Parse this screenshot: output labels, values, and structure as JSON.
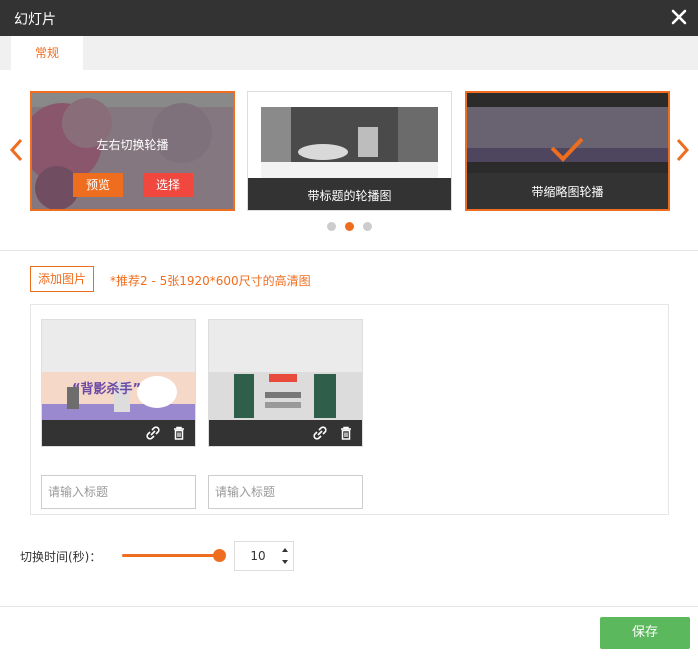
{
  "window": {
    "title": "幻灯片"
  },
  "tabs": [
    {
      "label": "常规"
    }
  ],
  "templates": [
    {
      "label": "左右切换轮播",
      "preview_label": "预览",
      "select_label": "选择"
    },
    {
      "label": "带标题的轮播图"
    },
    {
      "label": "带缩略图轮播"
    }
  ],
  "carousel": {
    "page_count": 3,
    "active_page": 2
  },
  "images": {
    "add_label": "添加图片",
    "hint": "*推荐2 - 5张1920*600尺寸的高清图",
    "items": [
      {
        "title_placeholder": "请输入标题",
        "banner_text": "“背影杀手”"
      },
      {
        "title_placeholder": "请输入标题",
        "banner_text": ""
      }
    ]
  },
  "interval": {
    "label": "切换时间(秒)：",
    "value": "10",
    "slider_fraction": 0.98
  },
  "footer": {
    "save_label": "保存"
  },
  "colors": {
    "accent": "#ef6d1e",
    "titlebar": "#333333",
    "save": "#5cb85c",
    "select": "#f0483e"
  },
  "icons": [
    "close-icon",
    "chevron-left-icon",
    "chevron-right-icon",
    "checkmark-icon",
    "link-icon",
    "trash-icon",
    "caret-up-icon",
    "caret-down-icon"
  ]
}
